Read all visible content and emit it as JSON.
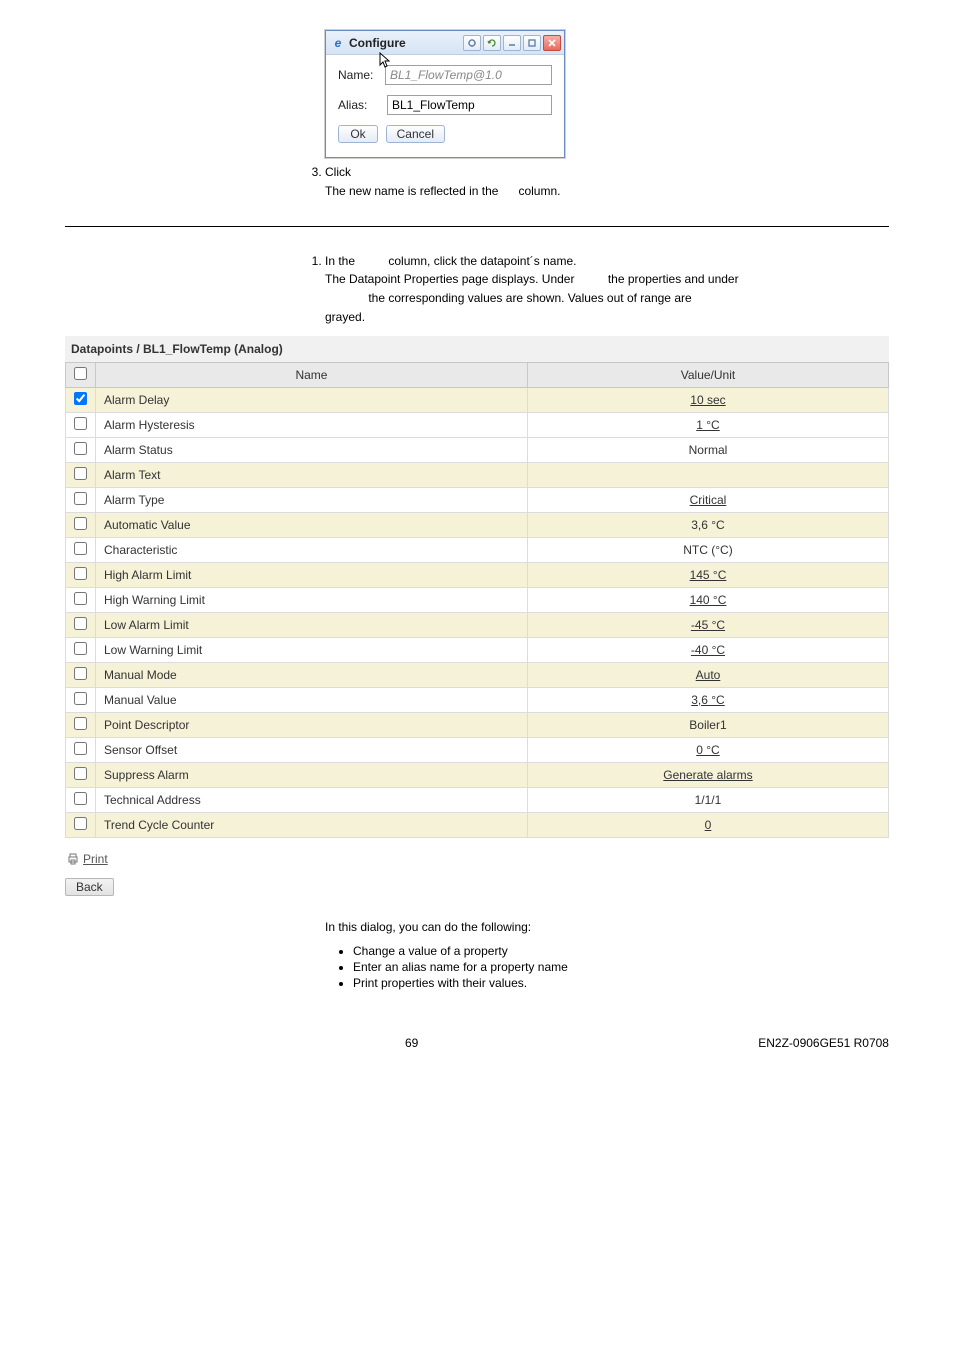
{
  "configure_window": {
    "title": "Configure",
    "fields": {
      "name_label": "Name:",
      "name_value": "BL1_FlowTemp@1.0",
      "alias_label": "Alias:",
      "alias_value": "BL1_FlowTemp"
    },
    "buttons": {
      "ok": "Ok",
      "cancel": "Cancel"
    }
  },
  "step3": {
    "num": "3.",
    "a": "Click",
    "b": "The new name is reflected in the",
    "c": "column."
  },
  "step1": {
    "num": "1.",
    "l1a": "In the",
    "l1b": "column, click the datapoint´s name.",
    "l2a": "The Datapoint Properties page displays. Under",
    "l2b": "the properties and under",
    "l3a": "the corresponding values are shown. Values out of range are",
    "l4": "grayed."
  },
  "dp": {
    "title": "Datapoints / BL1_FlowTemp (Analog)",
    "headers": {
      "name": "Name",
      "value": "Value/Unit"
    },
    "rows": [
      {
        "checked": true,
        "alt": true,
        "name": "Alarm Delay",
        "value": "10 sec",
        "link": true
      },
      {
        "checked": false,
        "alt": false,
        "name": "Alarm Hysteresis",
        "value": "1 °C",
        "link": true
      },
      {
        "checked": false,
        "alt": false,
        "name": "Alarm Status",
        "value": "Normal",
        "link": false
      },
      {
        "checked": false,
        "alt": true,
        "name": "Alarm Text",
        "value": "",
        "link": false
      },
      {
        "checked": false,
        "alt": false,
        "name": "Alarm Type",
        "value": "Critical",
        "link": true
      },
      {
        "checked": false,
        "alt": true,
        "name": "Automatic Value",
        "value": "3,6 °C",
        "link": false
      },
      {
        "checked": false,
        "alt": false,
        "name": "Characteristic",
        "value": "NTC (°C)",
        "link": false
      },
      {
        "checked": false,
        "alt": true,
        "name": "High Alarm Limit",
        "value": "145 °C",
        "link": true
      },
      {
        "checked": false,
        "alt": false,
        "name": "High Warning Limit",
        "value": "140 °C",
        "link": true
      },
      {
        "checked": false,
        "alt": true,
        "name": "Low Alarm Limit",
        "value": "-45 °C",
        "link": true
      },
      {
        "checked": false,
        "alt": false,
        "name": "Low Warning Limit",
        "value": "-40 °C",
        "link": true
      },
      {
        "checked": false,
        "alt": true,
        "name": "Manual Mode",
        "value": "Auto",
        "link": true
      },
      {
        "checked": false,
        "alt": false,
        "name": "Manual Value",
        "value": "3,6 °C",
        "link": true
      },
      {
        "checked": false,
        "alt": true,
        "name": "Point Descriptor",
        "value": "Boiler1",
        "link": false
      },
      {
        "checked": false,
        "alt": false,
        "name": "Sensor Offset",
        "value": "0 °C",
        "link": true
      },
      {
        "checked": false,
        "alt": true,
        "name": "Suppress Alarm",
        "value": "Generate alarms",
        "link": true
      },
      {
        "checked": false,
        "alt": false,
        "name": "Technical Address",
        "value": "1/1/1",
        "link": false
      },
      {
        "checked": false,
        "alt": true,
        "name": "Trend Cycle Counter",
        "value": "0",
        "link": true
      }
    ]
  },
  "links": {
    "print": "Print",
    "back": "Back"
  },
  "lower": {
    "intro": "In this dialog, you can do the following:",
    "b1": "Change a value of a property",
    "b2": "Enter an alias name for a property name",
    "b3": "Print properties with their values."
  },
  "footer": {
    "page": "69",
    "code": "EN2Z-0906GE51 R0708"
  }
}
